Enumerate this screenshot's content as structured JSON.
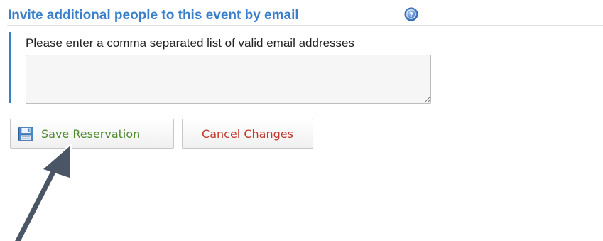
{
  "invite_section": {
    "title": "Invite additional people to this event by email",
    "help_icon": "question-circle-icon",
    "field_label": "Please enter a comma separated list of valid email addresses",
    "textarea_value": "",
    "accent_color": "#3a7fcb"
  },
  "actions": {
    "save_label": "Save Reservation",
    "save_icon": "floppy-disk-icon",
    "save_color": "#4e8a2e",
    "cancel_label": "Cancel Changes",
    "cancel_color": "#c0392b"
  },
  "annotation": {
    "arrow_icon": "pointer-arrow-icon",
    "arrow_color": "#4a5566"
  }
}
